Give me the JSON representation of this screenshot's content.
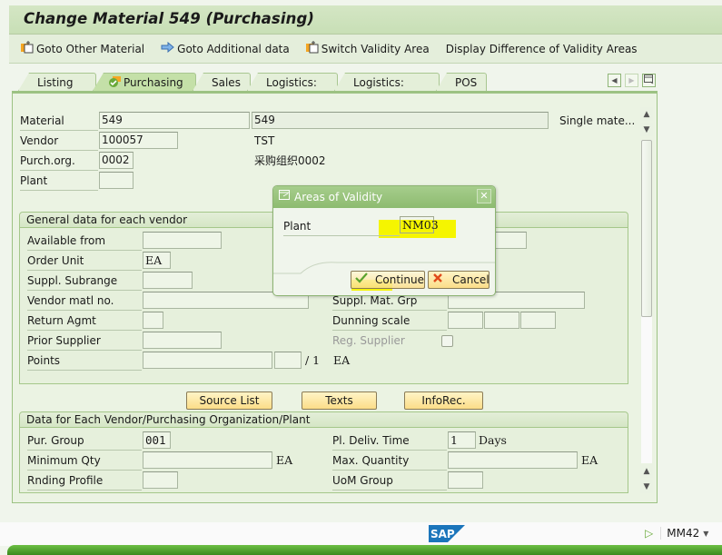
{
  "window": {
    "title": "Change Material 549 (Purchasing)"
  },
  "app_toolbar": {
    "items": [
      {
        "label": "Goto Other Material",
        "icon": "other-object-icon"
      },
      {
        "label": "Goto Additional data",
        "icon": "arrow-right-icon"
      },
      {
        "label": "Switch Validity Area",
        "icon": "other-object-icon"
      },
      {
        "label": "Display Difference of Validity Areas",
        "icon": ""
      }
    ]
  },
  "tabs": [
    {
      "label": "Listing",
      "active": false
    },
    {
      "label": "Purchasing",
      "active": true,
      "icon": "check-status-icon"
    },
    {
      "label": "Sales",
      "active": false
    },
    {
      "label": "Logistics: DC",
      "active": false
    },
    {
      "label": "Logistics: Store",
      "active": false
    },
    {
      "label": "POS",
      "active": false
    }
  ],
  "header": {
    "material_label": "Material",
    "material_value": "549",
    "material_desc": "549",
    "material_type": "Single mate...",
    "vendor_label": "Vendor",
    "vendor_value": "100057",
    "vendor_name": "TST",
    "purch_org_label": "Purch.org.",
    "purch_org_value": "0002",
    "purch_org_name": "采购组织0002",
    "plant_label": "Plant",
    "plant_value": ""
  },
  "general_vendor": {
    "title": "General data for each vendor",
    "available_from_label": "Available from",
    "available_from_value": "",
    "order_unit_label": "Order Unit",
    "order_unit_value": "EA",
    "suppl_subrange_label": "Suppl. Subrange",
    "suppl_subrange_value": "",
    "vendor_matl_label": "Vendor matl no.",
    "vendor_matl_value": "",
    "return_agmt_label": "Return Agmt",
    "return_agmt_value": "",
    "prior_supplier_label": "Prior Supplier",
    "prior_supplier_value": "",
    "points_label": "Points",
    "points_value": "",
    "points_unit_value": "",
    "points_per": "/ 1",
    "points_uom": "EA",
    "suppl_mat_grp_label": "Suppl. Mat. Grp",
    "suppl_mat_grp_value": "",
    "dunning_scale_label": "Dunning scale",
    "reg_supplier_label": "Reg. Supplier",
    "reg_supplier_checked": false
  },
  "buttons": {
    "source_list": "Source List",
    "texts": "Texts",
    "inforec": "InfoRec."
  },
  "vendor_porg_plant": {
    "title": "Data for Each Vendor/Purchasing Organization/Plant",
    "pur_group_label": "Pur. Group",
    "pur_group_value": "001",
    "min_qty_label": "Minimum Qty",
    "min_qty_value": "",
    "min_qty_uom": "EA",
    "rnding_label": "Rnding Profile",
    "rnding_value": "",
    "deliv_time_label": "Pl. Deliv. Time",
    "deliv_time_value": "1",
    "deliv_time_unit": "Days",
    "max_qty_label": "Max. Quantity",
    "max_qty_value": "",
    "max_qty_uom": "EA",
    "uom_group_label": "UoM Group",
    "uom_group_value": ""
  },
  "dialog": {
    "title": "Areas of Validity",
    "plant_label": "Plant",
    "plant_value": "NM03",
    "continue_label": "Continue",
    "cancel_label": "Cancel",
    "highlight_color": "#f5f500"
  },
  "statusbar": {
    "logo": "SAP",
    "transaction": "MM42"
  }
}
